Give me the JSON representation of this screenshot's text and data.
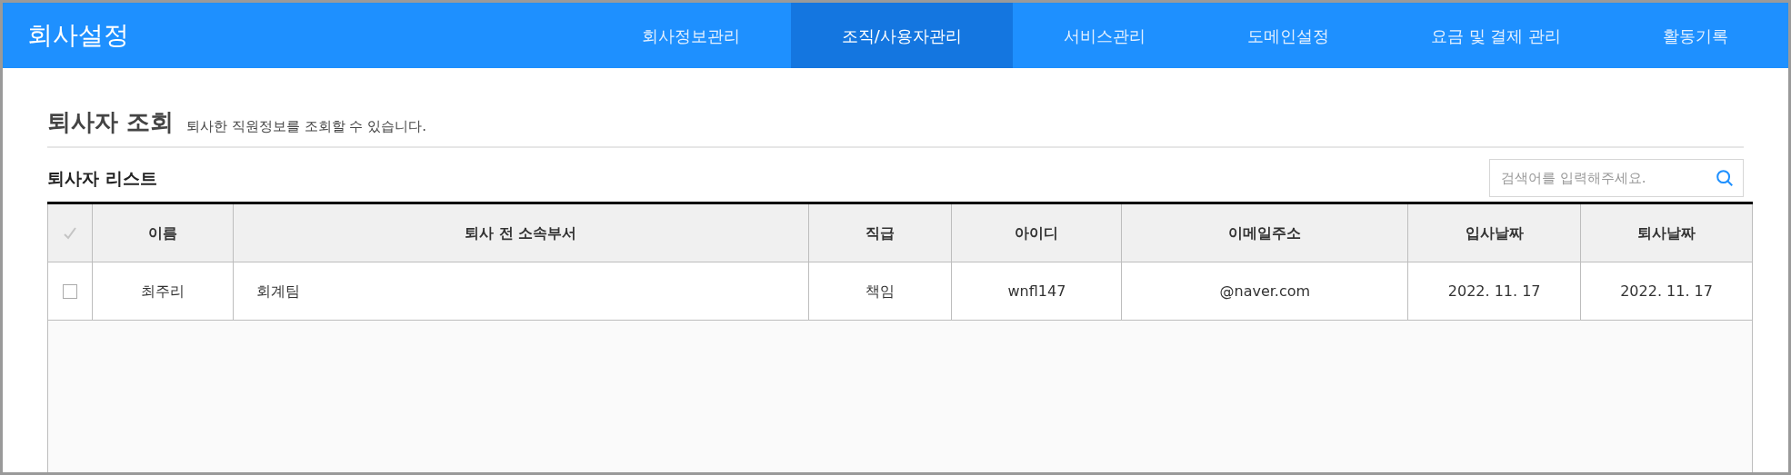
{
  "header": {
    "title": "회사설정",
    "nav": [
      {
        "label": "회사정보관리",
        "selected": false
      },
      {
        "label": "조직/사용자관리",
        "selected": true
      },
      {
        "label": "서비스관리",
        "selected": false
      },
      {
        "label": "도메인설정",
        "selected": false
      },
      {
        "label": "요금 및 결제 관리",
        "selected": false
      },
      {
        "label": "활동기록",
        "selected": false
      }
    ]
  },
  "page": {
    "title": "퇴사자 조회",
    "description": "퇴사한 직원정보를 조회할 수 있습니다."
  },
  "list": {
    "title": "퇴사자 리스트",
    "search": {
      "placeholder": "검색어를 입력해주세요."
    },
    "table": {
      "columns": [
        "이름",
        "퇴사 전 소속부서",
        "직급",
        "아이디",
        "이메일주소",
        "입사날짜",
        "퇴사날짜"
      ],
      "rows": [
        {
          "checked": false,
          "cells": [
            "최주리",
            "회계팀",
            "책임",
            "wnfl147",
            "@naver.com",
            "2022. 11. 17",
            "2022. 11. 17"
          ]
        }
      ]
    }
  }
}
